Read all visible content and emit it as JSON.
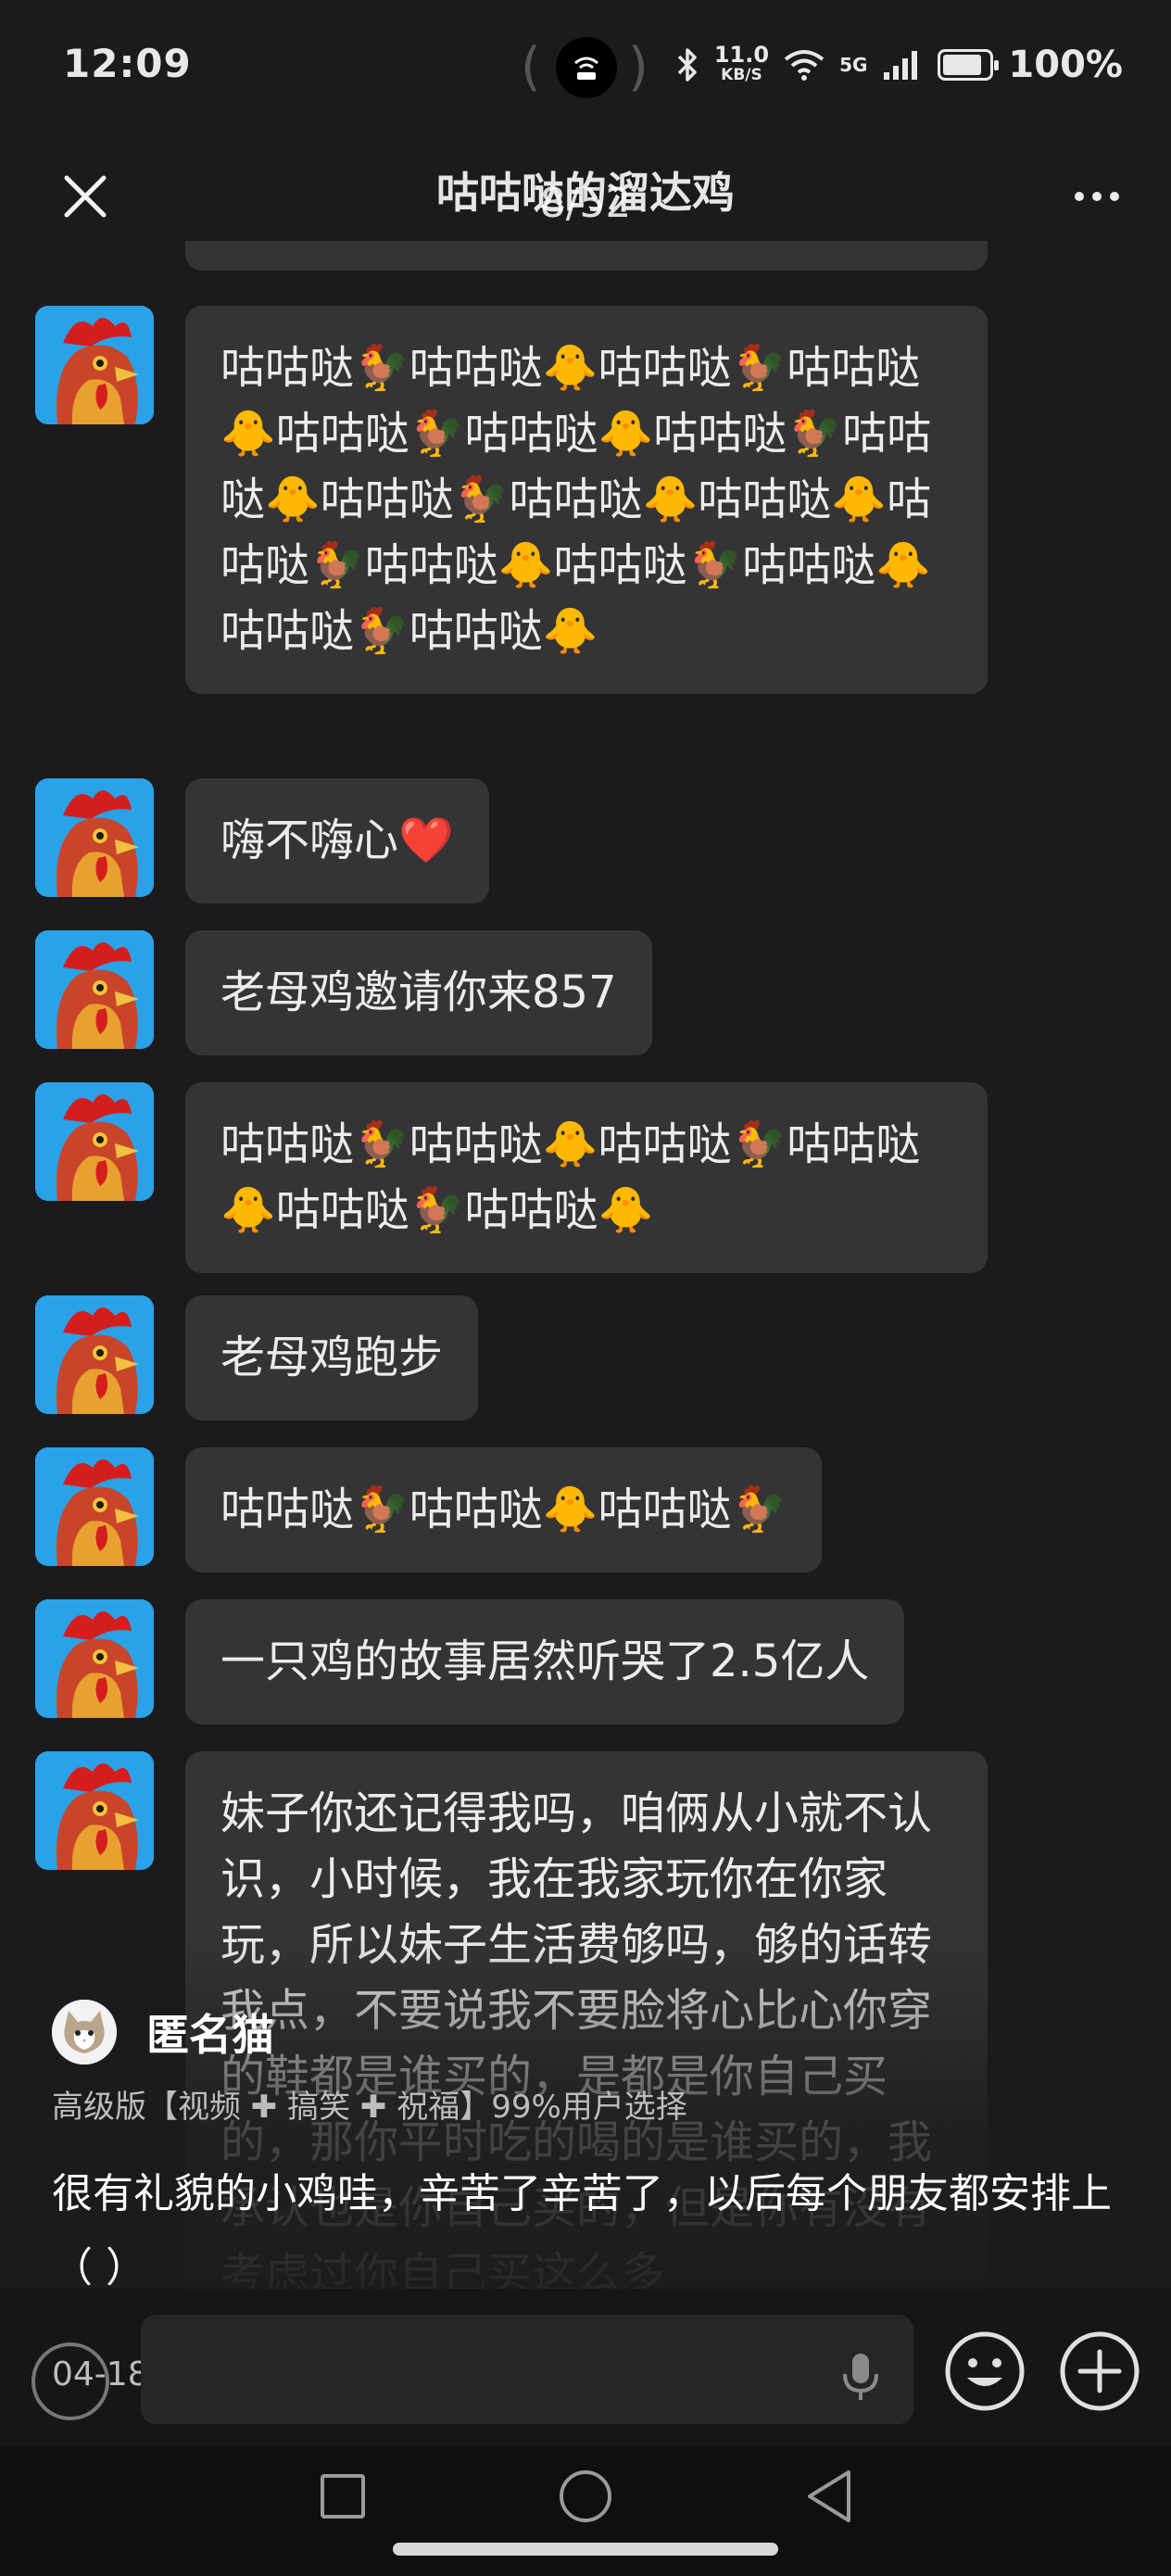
{
  "status_bar": {
    "time": "12:09",
    "net_speed": "11.0",
    "net_speed_unit": "KB/S",
    "signal_label": "5G",
    "battery_percent": "100%",
    "battery_level": 0.85
  },
  "header": {
    "title": "咕咕哒的溜达鸡",
    "counter": "8/52",
    "icons": [
      "close-icon",
      "more-icon"
    ]
  },
  "messages": [
    {
      "text": "咕咕哒🐓咕咕哒🐥咕咕哒🐓咕咕哒🐥咕咕哒🐓咕咕哒🐥咕咕哒🐓咕咕哒🐥咕咕哒🐓咕咕哒🐥咕咕哒🐥咕咕哒🐓咕咕哒🐥咕咕哒🐓咕咕哒🐥咕咕哒🐓咕咕哒🐥"
    },
    {
      "text": "嗨不嗨心❤️"
    },
    {
      "text": "老母鸡邀请你来857"
    },
    {
      "text": "咕咕哒🐓咕咕哒🐥咕咕哒🐓咕咕哒🐥咕咕哒🐓咕咕哒🐥"
    },
    {
      "text": "老母鸡跑步"
    },
    {
      "text": "咕咕哒🐓咕咕哒🐥咕咕哒🐓"
    },
    {
      "text": "一只鸡的故事居然听哭了2.5亿人"
    },
    {
      "text": "妹子你还记得我吗，咱俩从小就不认识，小时候，我在我家玩你在你家玩，所以妹子生活费够吗，够的话转我点，不要说我不要脸将心比心你穿的鞋都是谁买的，是都是你自己买的，那你平时吃的喝的是谁买的，我承认也是你自己买的，但是你有没有考虑过你自己买这么多"
    }
  ],
  "overlay": {
    "author": "匿名猫",
    "promo": "高级版【视频 ✚ 搞笑 ✚ 祝福】99%用户选择",
    "caption": "很有礼貌的小鸡哇，辛苦了辛苦了，以后每个朋友都安排上（ ）"
  },
  "input_bar": {
    "date": "04-18",
    "icons": [
      "voice-icon",
      "mic-icon",
      "emoji-icon",
      "plus-icon"
    ]
  },
  "nav_bar": {
    "icons": [
      "recent-apps-icon",
      "home-icon",
      "back-icon"
    ]
  },
  "colors": {
    "background": "#1b1b1d",
    "bubble": "#343436",
    "text": "#ececec",
    "avatar_bg": "#2aa2e8"
  }
}
